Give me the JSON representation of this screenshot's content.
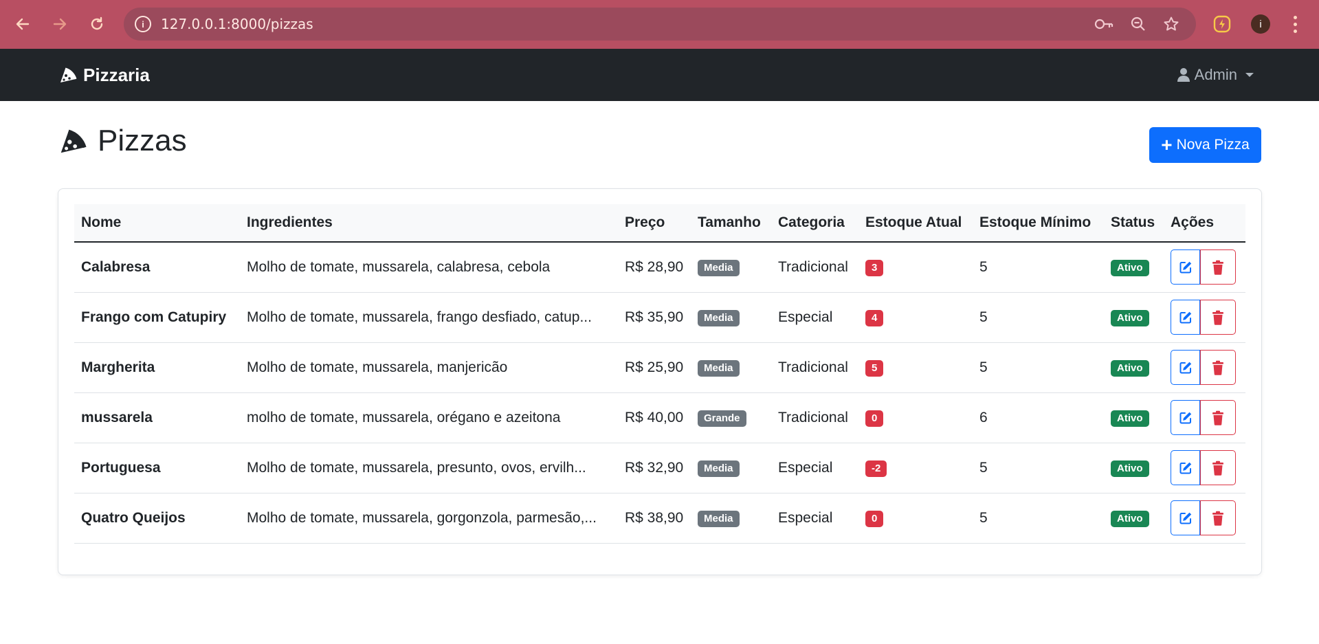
{
  "browser": {
    "url": "127.0.0.1:8000/pizzas",
    "profile_initial": "i"
  },
  "navbar": {
    "brand": "Pizzaria",
    "user": "Admin"
  },
  "page": {
    "title": "Pizzas",
    "new_button": "Nova Pizza"
  },
  "table": {
    "headers": {
      "nome": "Nome",
      "ingredientes": "Ingredientes",
      "preco": "Preço",
      "tamanho": "Tamanho",
      "categoria": "Categoria",
      "estoque_atual": "Estoque Atual",
      "estoque_minimo": "Estoque Mínimo",
      "status": "Status",
      "acoes": "Ações"
    },
    "rows": [
      {
        "nome": "Calabresa",
        "ingredientes": "Molho de tomate, mussarela, calabresa, cebola",
        "preco": "R$ 28,90",
        "tamanho": "Media",
        "categoria": "Tradicional",
        "estoque_atual": "3",
        "estoque_minimo": "5",
        "status": "Ativo"
      },
      {
        "nome": "Frango com Catupiry",
        "ingredientes": "Molho de tomate, mussarela, frango desfiado, catup...",
        "preco": "R$ 35,90",
        "tamanho": "Media",
        "categoria": "Especial",
        "estoque_atual": "4",
        "estoque_minimo": "5",
        "status": "Ativo"
      },
      {
        "nome": "Margherita",
        "ingredientes": "Molho de tomate, mussarela, manjericão",
        "preco": "R$ 25,90",
        "tamanho": "Media",
        "categoria": "Tradicional",
        "estoque_atual": "5",
        "estoque_minimo": "5",
        "status": "Ativo"
      },
      {
        "nome": "mussarela",
        "ingredientes": "molho de tomate, mussarela, orégano e azeitona",
        "preco": "R$ 40,00",
        "tamanho": "Grande",
        "categoria": "Tradicional",
        "estoque_atual": "0",
        "estoque_minimo": "6",
        "status": "Ativo"
      },
      {
        "nome": "Portuguesa",
        "ingredientes": "Molho de tomate, mussarela, presunto, ovos, ervilh...",
        "preco": "R$ 32,90",
        "tamanho": "Media",
        "categoria": "Especial",
        "estoque_atual": "-2",
        "estoque_minimo": "5",
        "status": "Ativo"
      },
      {
        "nome": "Quatro Queijos",
        "ingredientes": "Molho de tomate, mussarela, gorgonzola, parmesão,...",
        "preco": "R$ 38,90",
        "tamanho": "Media",
        "categoria": "Especial",
        "estoque_atual": "0",
        "estoque_minimo": "5",
        "status": "Ativo"
      }
    ]
  },
  "icons": {
    "back": "arrow-left-icon",
    "forward": "arrow-right-icon",
    "reload": "reload-icon",
    "site_info": "info-icon",
    "password": "key-icon",
    "zoom": "zoom-out-icon",
    "bookmark": "star-icon",
    "extension": "lightning-icon",
    "menu": "kebab-menu-icon",
    "brand": "pizza-slice-icon",
    "user": "user-icon",
    "edit": "edit-icon",
    "delete": "trash-icon"
  },
  "colors": {
    "browser_frame": "#b84f62",
    "navbar": "#212529",
    "primary": "#0d6efd",
    "danger": "#dc3545",
    "success": "#198754",
    "secondary": "#6c757d"
  }
}
